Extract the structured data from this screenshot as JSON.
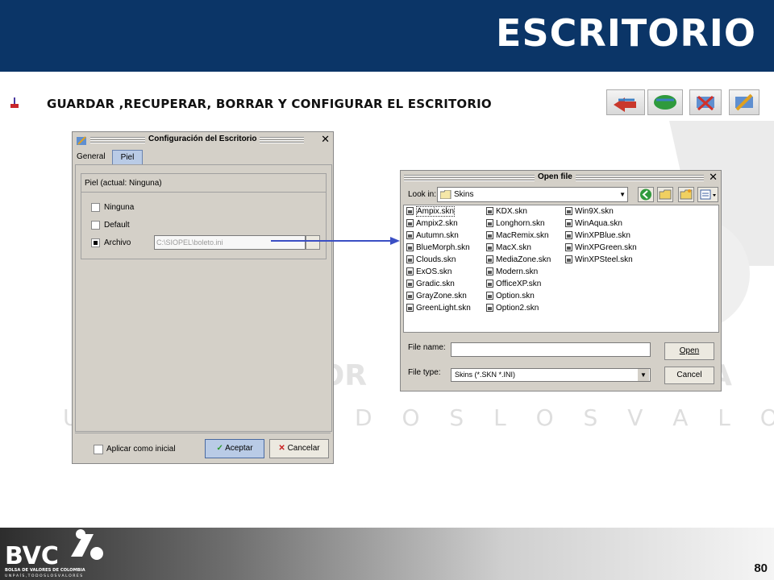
{
  "slide": {
    "title": "ESCRITORIO",
    "subtitle": "GUARDAR ,RECUPERAR, BORRAR Y CONFIGURAR EL ESCRITORIO",
    "page_number": "80",
    "toolbar_icons": [
      "save-desktop-icon",
      "recover-desktop-icon",
      "delete-desktop-icon",
      "configure-desktop-icon"
    ],
    "watermark": "D O S   L O S   V A L O R E S",
    "watermark_letters_a": "LOR",
    "watermark_letters_b": "A",
    "colors": {
      "header": "#0b3567",
      "accent": "#3b4fc4"
    }
  },
  "logo": {
    "name": "BVC",
    "line1": "BOLSA DE VALORES DE COLOMBIA",
    "line2": "U N  P A Í S ,  T O D O S  L O S  V A L O R E S"
  },
  "config_dialog": {
    "title": "Configuración del Escritorio",
    "tabs": [
      "General",
      "Piel"
    ],
    "active_tab": "Piel",
    "group_label": "Piel (actual: Ninguna)",
    "options": [
      {
        "label": "Ninguna",
        "checked": false
      },
      {
        "label": "Default",
        "checked": false
      },
      {
        "label": "Archivo",
        "checked": true
      }
    ],
    "path_value": "C:\\SIOPEL\\boleto.ini",
    "apply_initial_label": "Aplicar como inicial",
    "accept_label": "Aceptar",
    "cancel_label": "Cancelar"
  },
  "open_dialog": {
    "title": "Open file",
    "look_in_label": "Look in:",
    "look_in_value": "Skins",
    "files_col1": [
      "Ampix.skn",
      "Ampix2.skn",
      "Autumn.skn",
      "BlueMorph.skn",
      "Clouds.skn",
      "ExOS.skn",
      "Gradic.skn",
      "GrayZone.skn",
      "GreenLight.skn"
    ],
    "files_col2": [
      "KDX.skn",
      "Longhorn.skn",
      "MacRemix.skn",
      "MacX.skn",
      "MediaZone.skn",
      "Modern.skn",
      "OfficeXP.skn",
      "Option.skn",
      "Option2.skn"
    ],
    "files_col3": [
      "Win9X.skn",
      "WinAqua.skn",
      "WinXPBlue.skn",
      "WinXPGreen.skn",
      "WinXPSteel.skn"
    ],
    "file_name_label": "File name:",
    "file_name_value": "",
    "file_type_label": "File type:",
    "file_type_value": "Skins (*.SKN *.INI)",
    "open_label": "Open",
    "cancel_label": "Cancel"
  }
}
